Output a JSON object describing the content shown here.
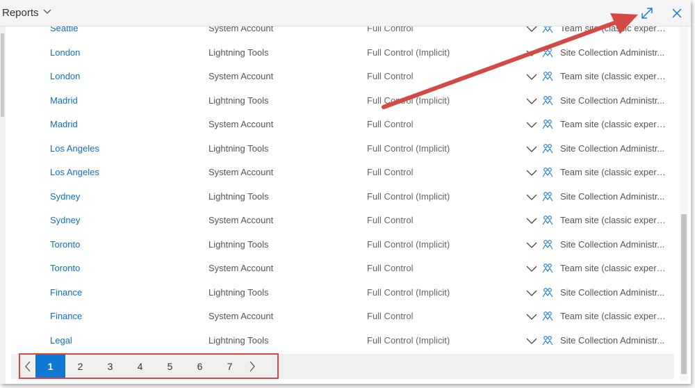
{
  "header": {
    "title": "Reports",
    "expand_icon": "expand-diagonal-icon",
    "close_icon": "close-icon"
  },
  "colors": {
    "link": "#0f6fc6",
    "accent": "#0f78d4",
    "annotation": "#d24a43"
  },
  "rows": [
    {
      "name": "Seattle",
      "user": "System Account",
      "permission": "Full Control",
      "site": "Team site (classic experie..."
    },
    {
      "name": "London",
      "user": "Lightning Tools",
      "permission": "Full Control (Implicit)",
      "site": "Site Collection Administr..."
    },
    {
      "name": "London",
      "user": "System Account",
      "permission": "Full Control",
      "site": "Team site (classic experie..."
    },
    {
      "name": "Madrid",
      "user": "Lightning Tools",
      "permission": "Full Control (Implicit)",
      "site": "Site Collection Administr..."
    },
    {
      "name": "Madrid",
      "user": "System Account",
      "permission": "Full Control",
      "site": "Team site (classic experie..."
    },
    {
      "name": "Los Angeles",
      "user": "Lightning Tools",
      "permission": "Full Control (Implicit)",
      "site": "Site Collection Administr..."
    },
    {
      "name": "Los Angeles",
      "user": "System Account",
      "permission": "Full Control",
      "site": "Team site (classic experie..."
    },
    {
      "name": "Sydney",
      "user": "Lightning Tools",
      "permission": "Full Control (Implicit)",
      "site": "Site Collection Administr..."
    },
    {
      "name": "Sydney",
      "user": "System Account",
      "permission": "Full Control",
      "site": "Team site (classic experie..."
    },
    {
      "name": "Toronto",
      "user": "Lightning Tools",
      "permission": "Full Control (Implicit)",
      "site": "Site Collection Administr..."
    },
    {
      "name": "Toronto",
      "user": "System Account",
      "permission": "Full Control",
      "site": "Team site (classic experie..."
    },
    {
      "name": "Finance",
      "user": "Lightning Tools",
      "permission": "Full Control (Implicit)",
      "site": "Site Collection Administr..."
    },
    {
      "name": "Finance",
      "user": "System Account",
      "permission": "Full Control",
      "site": "Team site (classic experie..."
    },
    {
      "name": "Legal",
      "user": "Lightning Tools",
      "permission": "Full Control (Implicit)",
      "site": "Site Collection Administr..."
    }
  ],
  "pager": {
    "pages": [
      "1",
      "2",
      "3",
      "4",
      "5",
      "6",
      "7"
    ],
    "active": "1",
    "prev_icon": "chevron-left-icon",
    "next_icon": "chevron-right-icon"
  }
}
